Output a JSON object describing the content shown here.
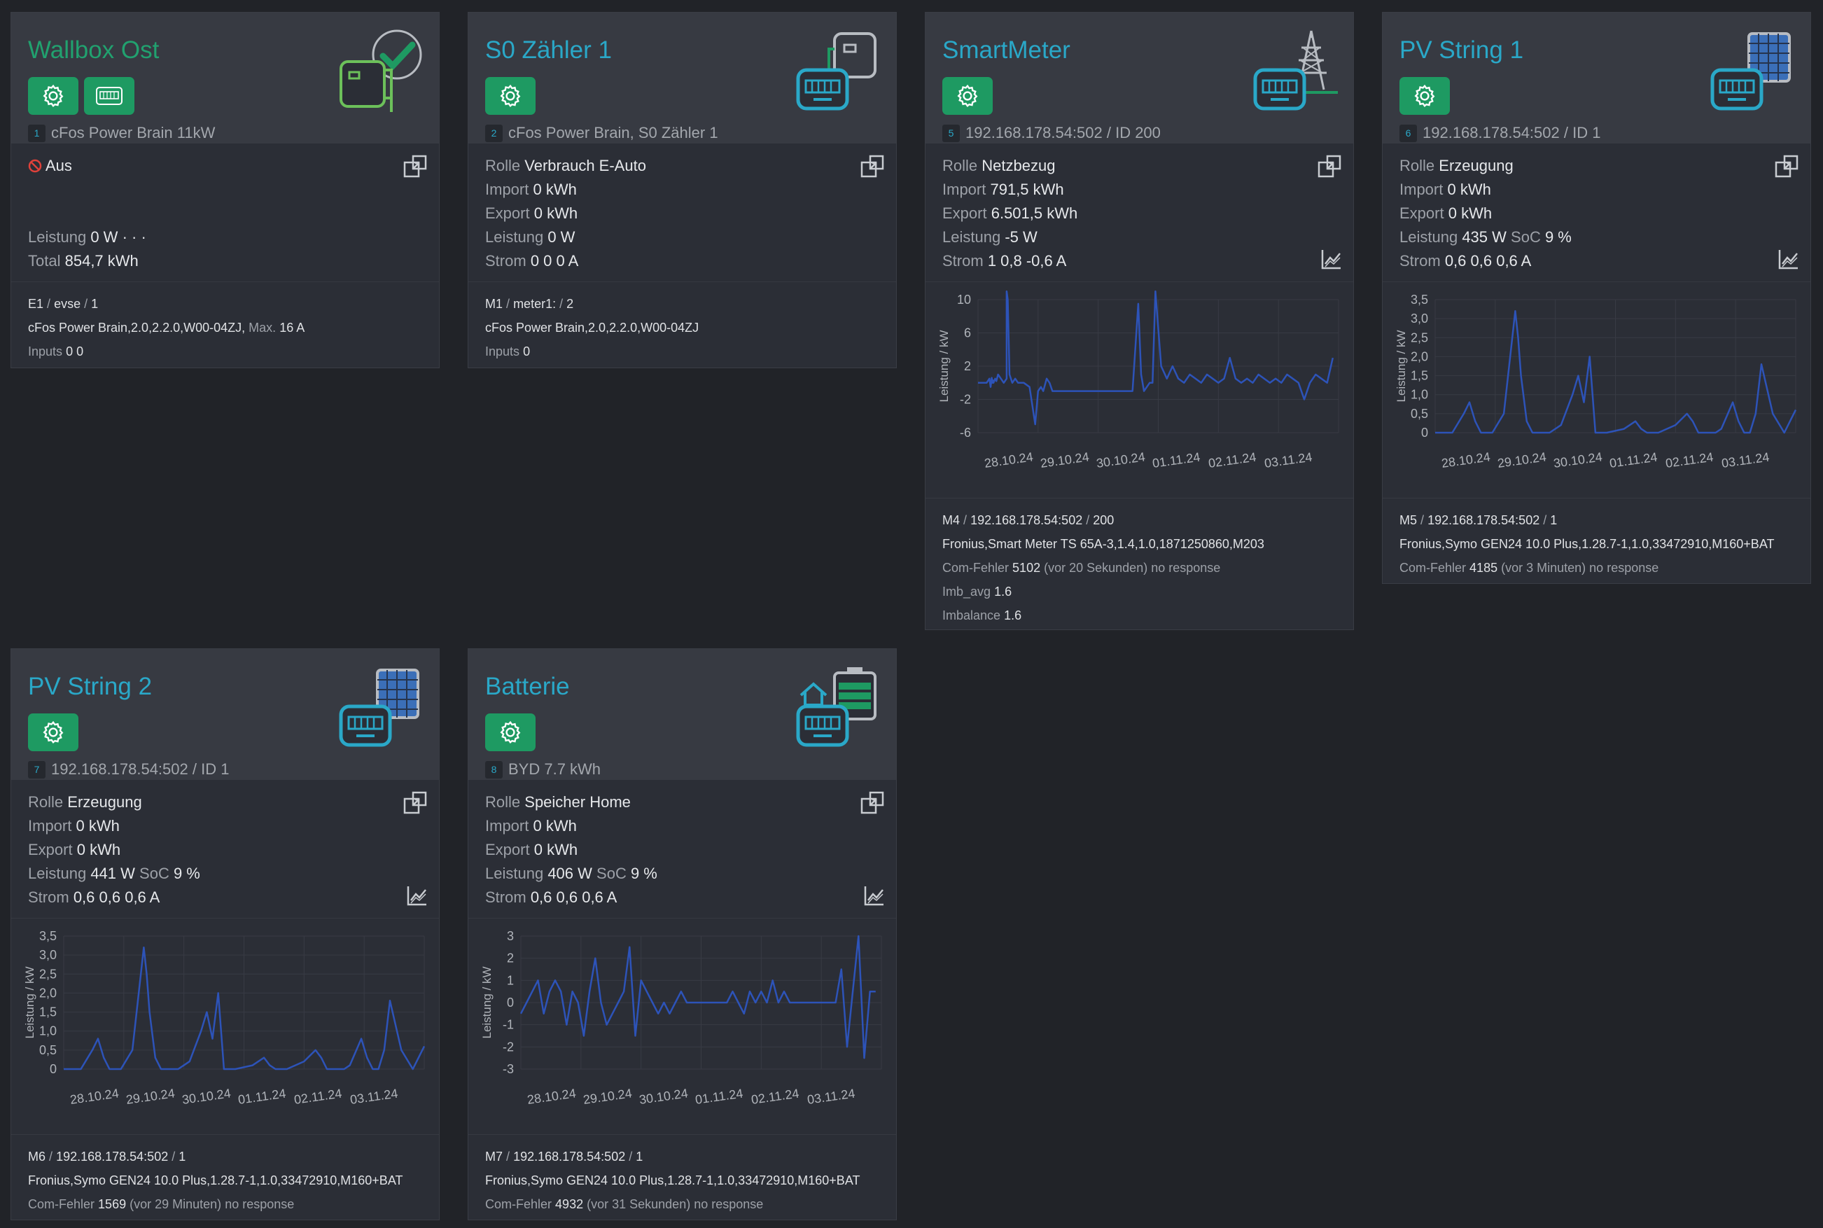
{
  "cards": [
    {
      "title": "Wallbox Ost",
      "index": "1",
      "subtitle": "cFos Power Brain 11kW",
      "state": "Aus",
      "stats": [
        {
          "label": "Leistung",
          "value": "0 W",
          "suffix": "· · ·"
        },
        {
          "label": "Total",
          "value": "854,7 kWh"
        }
      ],
      "footer": {
        "line1": {
          "a": "E1",
          "b": "evse",
          "c": "1"
        },
        "line2": "cFos Power Brain,2.0,2.2.0,W00-04ZJ",
        "max_label": "Max.",
        "max_value": "16 A",
        "inputs_label": "Inputs",
        "inputs_value": "0 0"
      }
    },
    {
      "title": "S0 Zähler 1",
      "index": "2",
      "subtitle": "cFos Power Brain, S0 Zähler 1",
      "stats": [
        {
          "label": "Rolle",
          "value": "Verbrauch E-Auto"
        },
        {
          "label": "Import",
          "value": "0 kWh"
        },
        {
          "label": "Export",
          "value": "0 kWh"
        },
        {
          "label": "Leistung",
          "value": "0 W"
        },
        {
          "label": "Strom",
          "value": "0 0 0 A"
        }
      ],
      "footer": {
        "line1": {
          "a": "M1",
          "b": "meter1:",
          "c": "2"
        },
        "line2": "cFos Power Brain,2.0,2.2.0,W00-04ZJ",
        "inputs_label": "Inputs",
        "inputs_value": "0"
      }
    },
    {
      "title": "SmartMeter",
      "index": "5",
      "subtitle": "192.168.178.54:502 / ID 200",
      "stats": [
        {
          "label": "Rolle",
          "value": "Netzbezug"
        },
        {
          "label": "Import",
          "value": "791,5 kWh"
        },
        {
          "label": "Export",
          "value": "6.501,5 kWh"
        },
        {
          "label": "Leistung",
          "value": "-5 W"
        },
        {
          "label": "Strom",
          "value": "1 0,8 -0,6 A"
        }
      ],
      "footer": {
        "line1": {
          "a": "M4",
          "b": "192.168.178.54:502",
          "c": "200"
        },
        "line2": "Fronius,Smart Meter TS 65A-3,1.4,1.0,1871250860,M203",
        "err_label": "Com-Fehler",
        "err_value": "5102",
        "err_time": "(vor 20 Sekunden)",
        "err_msg": "no response",
        "imb_avg_label": "Imb_avg",
        "imb_avg_value": "1.6",
        "imbalance_label": "Imbalance",
        "imbalance_value": "1.6"
      }
    },
    {
      "title": "PV String 1",
      "index": "6",
      "subtitle": "192.168.178.54:502 / ID 1",
      "stats": [
        {
          "label": "Rolle",
          "value": "Erzeugung"
        },
        {
          "label": "Import",
          "value": "0 kWh"
        },
        {
          "label": "Export",
          "value": "0 kWh"
        },
        {
          "label": "Leistung",
          "value": "435 W",
          "label2": "SoC",
          "value2": "9 %"
        },
        {
          "label": "Strom",
          "value": "0,6 0,6 0,6 A"
        }
      ],
      "footer": {
        "line1": {
          "a": "M5",
          "b": "192.168.178.54:502",
          "c": "1"
        },
        "line2": "Fronius,Symo GEN24 10.0 Plus,1.28.7-1,1.0,33472910,M160+BAT",
        "err_label": "Com-Fehler",
        "err_value": "4185",
        "err_time": "(vor 3 Minuten)",
        "err_msg": "no response"
      }
    },
    {
      "title": "PV String 2",
      "index": "7",
      "subtitle": "192.168.178.54:502 / ID 1",
      "stats": [
        {
          "label": "Rolle",
          "value": "Erzeugung"
        },
        {
          "label": "Import",
          "value": "0 kWh"
        },
        {
          "label": "Export",
          "value": "0 kWh"
        },
        {
          "label": "Leistung",
          "value": "441 W",
          "label2": "SoC",
          "value2": "9 %"
        },
        {
          "label": "Strom",
          "value": "0,6 0,6 0,6 A"
        }
      ],
      "footer": {
        "line1": {
          "a": "M6",
          "b": "192.168.178.54:502",
          "c": "1"
        },
        "line2": "Fronius,Symo GEN24 10.0 Plus,1.28.7-1,1.0,33472910,M160+BAT",
        "err_label": "Com-Fehler",
        "err_value": "1569",
        "err_time": "(vor 29 Minuten)",
        "err_msg": "no response"
      }
    },
    {
      "title": "Batterie",
      "index": "8",
      "subtitle": "BYD 7.7 kWh",
      "stats": [
        {
          "label": "Rolle",
          "value": "Speicher Home"
        },
        {
          "label": "Import",
          "value": "0 kWh"
        },
        {
          "label": "Export",
          "value": "0 kWh"
        },
        {
          "label": "Leistung",
          "value": "406 W",
          "label2": "SoC",
          "value2": "9 %"
        },
        {
          "label": "Strom",
          "value": "0,6 0,6 0,6 A"
        }
      ],
      "footer": {
        "line1": {
          "a": "M7",
          "b": "192.168.178.54:502",
          "c": "1"
        },
        "line2": "Fronius,Symo GEN24 10.0 Plus,1.28.7-1,1.0,33472910,M160+BAT",
        "err_label": "Com-Fehler",
        "err_value": "4932",
        "err_time": "(vor 31 Sekunden)",
        "err_msg": "no response"
      }
    }
  ],
  "chart_data": [
    {
      "type": "line",
      "card": "SmartMeter",
      "ylabel": "Leistung / kW",
      "yticks": [
        "10",
        "6",
        "2",
        "-2",
        "-6"
      ],
      "ylim": [
        -6,
        10
      ],
      "xticks": [
        "28.10.24",
        "29.10.24",
        "30.10.24",
        "01.11.24",
        "02.11.24",
        "03.11.24"
      ],
      "x": [
        0,
        0.15,
        0.2,
        0.22,
        0.24,
        0.25,
        0.26,
        0.27,
        0.3,
        0.32,
        0.35,
        0.4,
        0.45,
        0.5,
        0.5,
        0.52,
        0.55,
        0.6,
        0.65,
        0.7,
        0.8,
        0.9,
        1.0,
        1.05,
        1.1,
        1.14,
        1.2,
        1.25,
        1.3,
        1.35,
        1.4,
        1.5,
        1.6,
        1.7,
        1.8,
        1.9,
        2.0,
        2.1,
        2.2,
        2.3,
        2.4,
        2.5,
        2.6,
        2.7,
        2.8,
        2.85,
        2.9,
        3.0,
        3.05,
        3.1,
        3.2,
        3.3,
        3.4,
        3.5,
        3.6,
        3.7,
        3.8,
        3.9,
        4.0,
        4.1,
        4.2,
        4.3,
        4.4,
        4.5,
        4.6,
        4.7,
        4.8,
        4.9,
        5.0,
        5.1,
        5.2,
        5.3,
        5.4,
        5.5,
        5.6,
        5.7,
        5.8,
        5.9,
        6.0,
        6.1,
        6.2
      ],
      "y": [
        0,
        0,
        0.5,
        -0.5,
        0.6,
        0,
        0.3,
        0,
        0.5,
        0.2,
        1,
        0.5,
        0,
        0.5,
        11,
        10,
        1,
        0,
        0.5,
        0,
        0,
        -0.5,
        -5,
        -1,
        -0.5,
        -1,
        0.5,
        0,
        -1,
        -1,
        -1,
        -1,
        -1,
        -1,
        -1,
        -1,
        -1,
        -1,
        -1,
        -1,
        -1,
        -1,
        -1,
        -1,
        9.5,
        1,
        -1,
        0,
        0,
        11,
        2,
        0.5,
        2,
        0.5,
        0,
        1,
        0.5,
        0,
        1,
        0.5,
        0,
        0.5,
        3,
        0.5,
        0,
        0.5,
        0,
        1,
        0.5,
        0,
        0.5,
        0,
        1,
        0.5,
        0,
        -2,
        0,
        1,
        0.5,
        0,
        3
      ]
    },
    {
      "type": "line",
      "card": "PV String 1",
      "ylabel": "Leistung / kW",
      "yticks": [
        "3,5",
        "3,0",
        "2,5",
        "2,0",
        "1,5",
        "1,0",
        "0,5",
        "0"
      ],
      "ylim": [
        0,
        3.5
      ],
      "xticks": [
        "28.10.24",
        "29.10.24",
        "30.10.24",
        "01.11.24",
        "02.11.24",
        "03.11.24"
      ],
      "x": [
        0,
        0.3,
        0.5,
        0.6,
        0.7,
        0.8,
        1.0,
        1.2,
        1.4,
        1.45,
        1.5,
        1.6,
        1.7,
        1.8,
        2.0,
        2.2,
        2.4,
        2.5,
        2.6,
        2.7,
        2.8,
        2.9,
        3.0,
        3.3,
        3.5,
        3.6,
        3.7,
        3.9,
        4.2,
        4.4,
        4.5,
        4.6,
        4.7,
        4.9,
        5.0,
        5.2,
        5.3,
        5.4,
        5.5,
        5.6,
        5.7,
        5.9,
        6.1,
        6.3
      ],
      "y": [
        0,
        0,
        0.5,
        0.8,
        0.3,
        0,
        0,
        0.5,
        3.2,
        2.5,
        1.5,
        0.3,
        0,
        0,
        0,
        0.2,
        1,
        1.5,
        0.8,
        2,
        0,
        0,
        0,
        0.1,
        0.3,
        0.1,
        0,
        0,
        0.2,
        0.5,
        0.3,
        0,
        0,
        0,
        0.1,
        0.8,
        0.3,
        0,
        0,
        0.5,
        1.8,
        0.5,
        0,
        0.6
      ]
    },
    {
      "type": "line",
      "card": "PV String 2",
      "ylabel": "Leistung / kW",
      "yticks": [
        "3,5",
        "3,0",
        "2,5",
        "2,0",
        "1,5",
        "1,0",
        "0,5",
        "0"
      ],
      "ylim": [
        0,
        3.5
      ],
      "xticks": [
        "28.10.24",
        "29.10.24",
        "30.10.24",
        "01.11.24",
        "02.11.24",
        "03.11.24"
      ],
      "x": [
        0,
        0.3,
        0.5,
        0.6,
        0.7,
        0.8,
        1.0,
        1.2,
        1.4,
        1.45,
        1.5,
        1.6,
        1.7,
        1.8,
        2.0,
        2.2,
        2.4,
        2.5,
        2.6,
        2.7,
        2.8,
        2.9,
        3.0,
        3.3,
        3.5,
        3.6,
        3.7,
        3.9,
        4.2,
        4.4,
        4.5,
        4.6,
        4.7,
        4.9,
        5.0,
        5.2,
        5.3,
        5.4,
        5.5,
        5.6,
        5.7,
        5.9,
        6.1,
        6.3
      ],
      "y": [
        0,
        0,
        0.5,
        0.8,
        0.3,
        0,
        0,
        0.5,
        3.2,
        2.5,
        1.5,
        0.3,
        0,
        0,
        0,
        0.2,
        1,
        1.5,
        0.8,
        2,
        0,
        0,
        0,
        0.1,
        0.3,
        0.1,
        0,
        0,
        0.2,
        0.5,
        0.3,
        0,
        0,
        0,
        0.1,
        0.8,
        0.3,
        0,
        0,
        0.5,
        1.8,
        0.5,
        0,
        0.6
      ]
    },
    {
      "type": "line",
      "card": "Batterie",
      "ylabel": "Leistung / kW",
      "yticks": [
        "3",
        "2",
        "1",
        "0",
        "-1",
        "-2",
        "-3"
      ],
      "ylim": [
        -3,
        3
      ],
      "xticks": [
        "28.10.24",
        "29.10.24",
        "30.10.24",
        "01.11.24",
        "02.11.24",
        "03.11.24"
      ],
      "x": [
        0,
        0.1,
        0.2,
        0.3,
        0.4,
        0.5,
        0.6,
        0.7,
        0.8,
        0.9,
        1.0,
        1.1,
        1.2,
        1.3,
        1.4,
        1.5,
        1.6,
        1.7,
        1.8,
        1.9,
        2.0,
        2.1,
        2.2,
        2.3,
        2.4,
        2.5,
        2.6,
        2.7,
        2.8,
        2.9,
        3.0,
        3.1,
        3.2,
        3.3,
        3.4,
        3.5,
        3.6,
        3.7,
        3.8,
        3.9,
        4.0,
        4.1,
        4.2,
        4.3,
        4.4,
        4.5,
        4.6,
        4.7,
        4.8,
        4.9,
        5.0,
        5.1,
        5.2,
        5.3,
        5.4,
        5.5,
        5.6,
        5.7,
        5.8,
        5.9,
        6.0,
        6.1,
        6.2
      ],
      "y": [
        -0.5,
        0,
        0.5,
        1,
        -0.5,
        0.5,
        1,
        0.5,
        -1,
        0.5,
        0,
        -1.5,
        0.5,
        2,
        0,
        -1,
        -0.5,
        0,
        0.5,
        2.5,
        -1.5,
        1,
        0.5,
        0,
        -0.5,
        0,
        -0.5,
        0,
        0.5,
        0,
        0,
        0,
        0,
        0,
        0,
        0,
        0,
        0.5,
        0,
        -0.5,
        0.5,
        0,
        0.5,
        0,
        1,
        0,
        0.5,
        0,
        0,
        0,
        0,
        0,
        0,
        0,
        0,
        0,
        1.5,
        -2,
        0.5,
        3,
        -2.5,
        0.5,
        0.5
      ]
    }
  ]
}
